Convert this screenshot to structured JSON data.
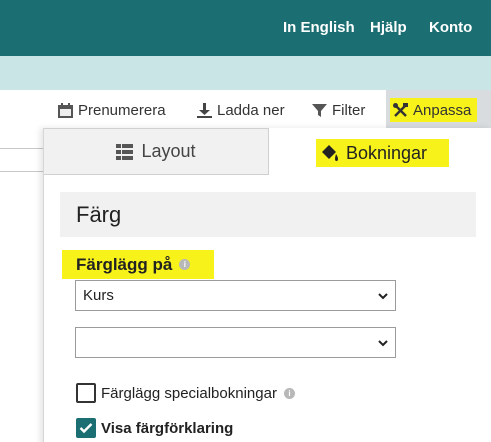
{
  "topnav": {
    "in_english": "In English",
    "help": "Hjälp",
    "account": "Konto"
  },
  "toolbar": {
    "subscribe": "Prenumerera",
    "download": "Ladda ner",
    "filter": "Filter",
    "customize": "Anpassa"
  },
  "tabs": {
    "layout": "Layout",
    "bookings": "Bokningar"
  },
  "section": {
    "title": "Färg",
    "color_by_label": "Färglägg på",
    "color_by_select": "Kurs",
    "second_select": "",
    "special_bookings_label": "Färglägg specialbokningar",
    "special_bookings_checked": false,
    "show_legend_label": "Visa färgförklaring",
    "show_legend_checked": true
  },
  "colors": {
    "topbar": "#1b6f72",
    "subbar": "#c9e5e6",
    "highlight": "#f7f21a"
  }
}
